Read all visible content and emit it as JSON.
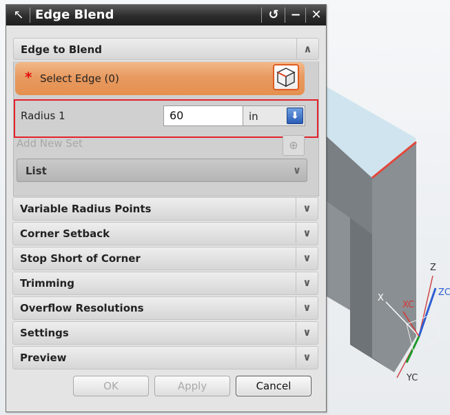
{
  "dialog": {
    "title": "Edge Blend",
    "title_buttons": {
      "reset": "↺",
      "minimize": "−",
      "close": "✕"
    }
  },
  "edge_to_blend": {
    "header": "Edge to Blend",
    "select_edge": {
      "required_mark": "*",
      "label": "Select Edge (0)"
    },
    "radius": {
      "label": "Radius 1",
      "value": "60",
      "unit": "in"
    },
    "add_new_set": "Add New Set",
    "list": {
      "label": "List"
    }
  },
  "sections": [
    {
      "label": "Variable Radius Points"
    },
    {
      "label": "Corner Setback"
    },
    {
      "label": "Stop Short of Corner"
    },
    {
      "label": "Trimming"
    },
    {
      "label": "Overflow Resolutions"
    },
    {
      "label": "Settings"
    },
    {
      "label": "Preview"
    }
  ],
  "footer": {
    "ok": "OK",
    "apply": "Apply",
    "cancel": "Cancel"
  },
  "viewport": {
    "axes": {
      "z": "Z",
      "zc": "ZC",
      "x": "X",
      "xc": "XC",
      "yc": "YC"
    }
  },
  "colors": {
    "accent_orange": "#e89a60",
    "highlight_red": "#e3202a",
    "title_bar": "#2c2c2c"
  }
}
